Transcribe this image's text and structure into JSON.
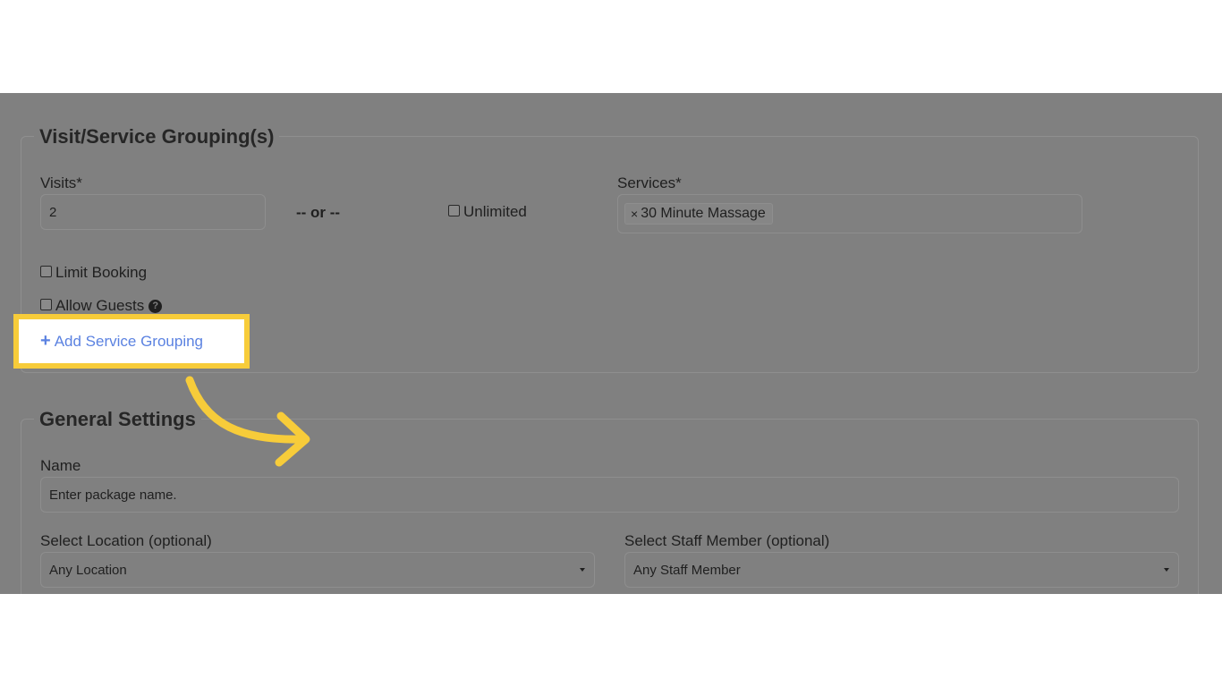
{
  "grouping": {
    "title": "Visit/Service Grouping(s)",
    "visits_label": "Visits*",
    "visits_value": "2",
    "or_text": "-- or --",
    "unlimited_label": "Unlimited",
    "services_label": "Services*",
    "service_tags": [
      "30 Minute Massage"
    ],
    "tag_remove_glyph": "×",
    "limit_booking_label": "Limit Booking",
    "allow_guests_label": "Allow Guests",
    "help_glyph": "?"
  },
  "add_grouping": {
    "plus_glyph": "+",
    "label": "Add Service Grouping"
  },
  "general": {
    "title": "General Settings",
    "name_label": "Name",
    "name_placeholder": "Enter package name.",
    "location_label": "Select Location (optional)",
    "location_value": "Any Location",
    "staff_label": "Select Staff Member (optional)",
    "staff_value": "Any Staff Member"
  },
  "colors": {
    "overlay": "#808080",
    "highlight_border": "#f7cc3a",
    "link": "#5b82e1"
  }
}
